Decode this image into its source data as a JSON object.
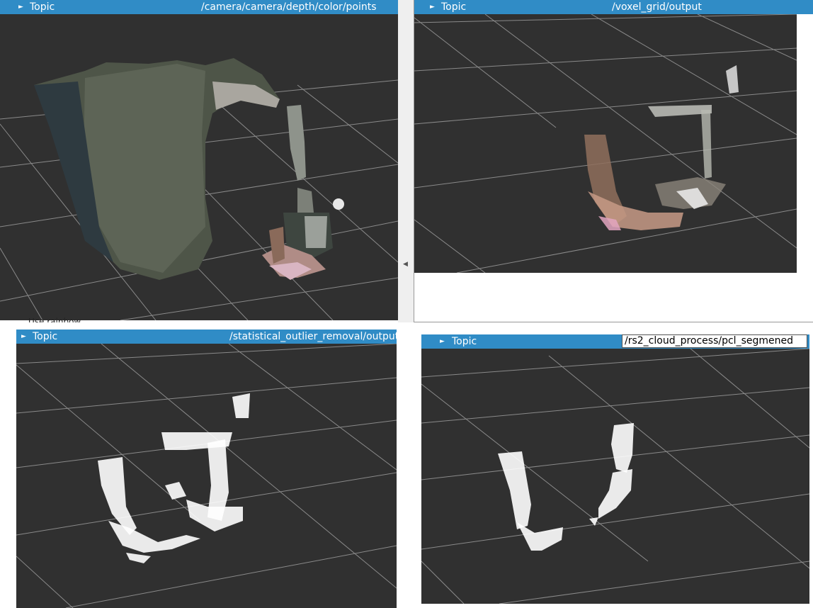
{
  "colors": {
    "topic_bar": "#308cc6",
    "viewport_bg": "#303030",
    "grid": "#8a8a8a",
    "points": "#ffffff"
  },
  "panels": [
    {
      "id": "top-left",
      "label": "Topic",
      "topic": "/camera/camera/depth/color/points",
      "icon": "expand-triangle-icon"
    },
    {
      "id": "top-right",
      "label": "Topic",
      "topic": "/voxel_grid/output",
      "icon": "expand-triangle-icon"
    },
    {
      "id": "bottom-left",
      "label": "Topic",
      "topic": "/statistical_outlier_removal/output",
      "icon": "expand-triangle-icon"
    },
    {
      "id": "bottom-right",
      "label": "Topic",
      "topic": "/rs2_cloud_process/pcl_segmened",
      "icon": "expand-triangle-icon",
      "editing": true
    }
  ],
  "behind": {
    "use_rainbow": "Use rainbow"
  }
}
